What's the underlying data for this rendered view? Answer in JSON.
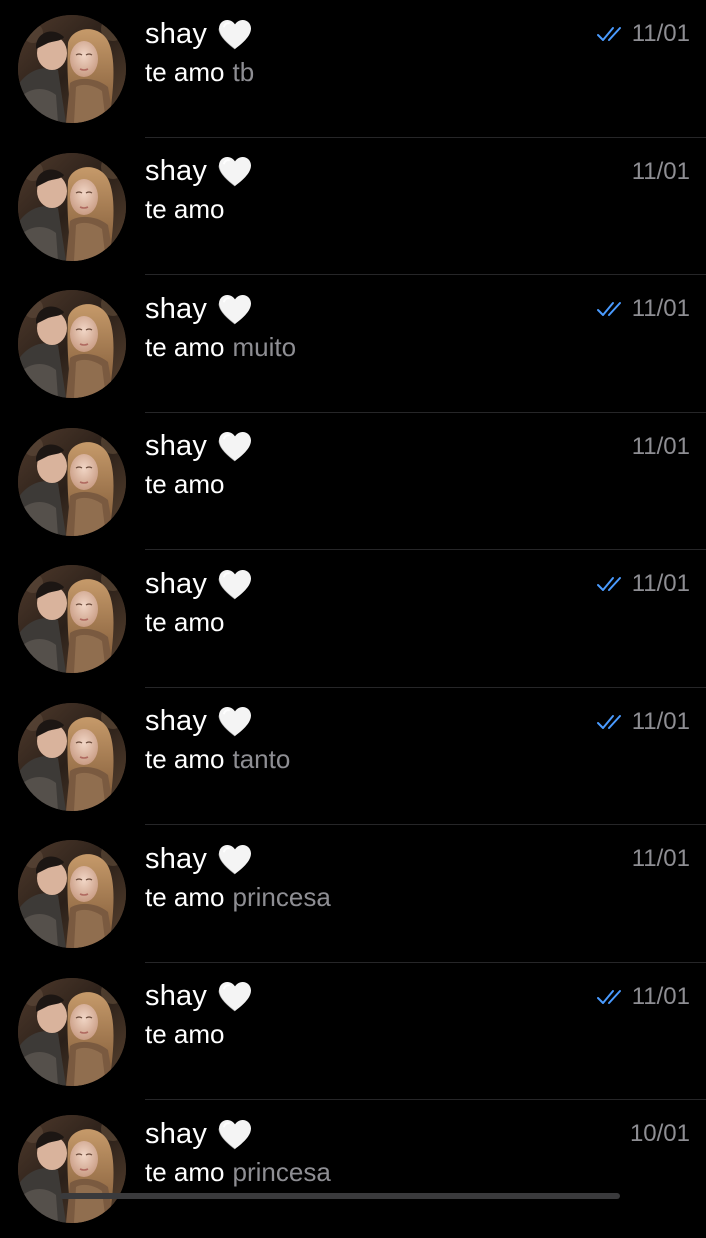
{
  "chats": [
    {
      "name": "shay",
      "preview_main": "te amo",
      "preview_extra": "tb",
      "time": "11/01",
      "read_ticks": true
    },
    {
      "name": "shay",
      "preview_main": "te amo",
      "preview_extra": "",
      "time": "11/01",
      "read_ticks": false
    },
    {
      "name": "shay",
      "preview_main": "te amo",
      "preview_extra": "muito",
      "time": "11/01",
      "read_ticks": true
    },
    {
      "name": "shay",
      "preview_main": "te amo",
      "preview_extra": "",
      "time": "11/01",
      "read_ticks": false
    },
    {
      "name": "shay",
      "preview_main": "te amo",
      "preview_extra": "",
      "time": "11/01",
      "read_ticks": true
    },
    {
      "name": "shay",
      "preview_main": "te amo",
      "preview_extra": "tanto",
      "time": "11/01",
      "read_ticks": true
    },
    {
      "name": "shay",
      "preview_main": "te amo",
      "preview_extra": "princesa",
      "time": "11/01",
      "read_ticks": false
    },
    {
      "name": "shay",
      "preview_main": "te amo",
      "preview_extra": "",
      "time": "11/01",
      "read_ticks": true
    },
    {
      "name": "shay",
      "preview_main": "te amo",
      "preview_extra": "princesa",
      "time": "10/01",
      "read_ticks": false
    }
  ],
  "icons": {
    "name_emoji": "white-heart-icon",
    "read_receipt": "double-check-icon",
    "avatar": "profile-photo"
  },
  "colors": {
    "background": "#000000",
    "name_text": "#ffffff",
    "secondary_text": "#8e8e93",
    "read_ticks": "#4a9bff",
    "separator": "#262628"
  }
}
